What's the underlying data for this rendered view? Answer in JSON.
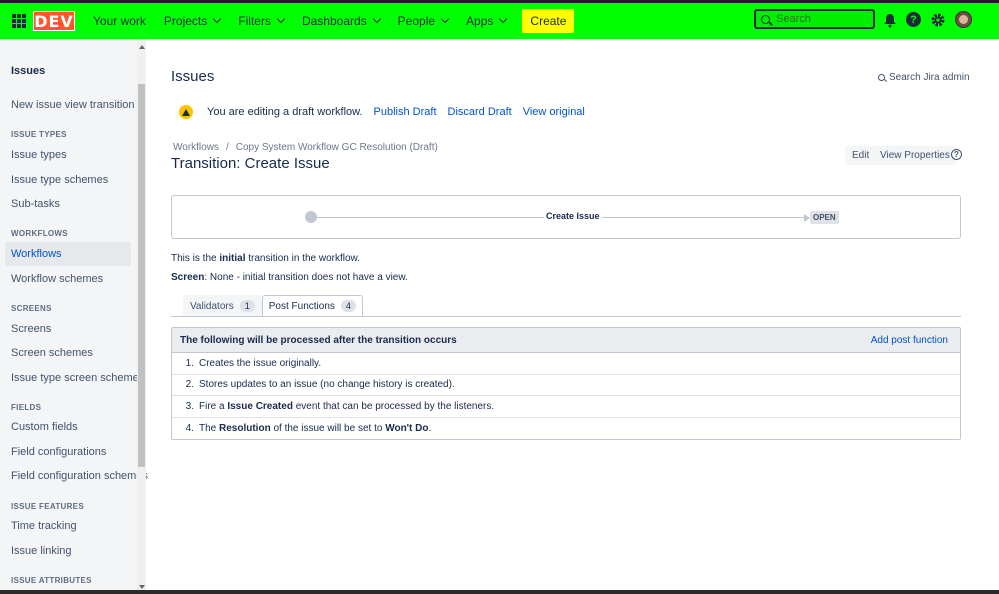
{
  "topbar": {
    "logo": "DEV",
    "nav": [
      {
        "label": "Your work",
        "dropdown": false
      },
      {
        "label": "Projects",
        "dropdown": true
      },
      {
        "label": "Filters",
        "dropdown": true
      },
      {
        "label": "Dashboards",
        "dropdown": true
      },
      {
        "label": "People",
        "dropdown": true
      },
      {
        "label": "Apps",
        "dropdown": true
      }
    ],
    "create_label": "Create",
    "search_placeholder": "Search",
    "help_glyph": "?",
    "colors": {
      "bar": "#00ff00",
      "create": "#ffff00",
      "logo": "#ff5630"
    },
    "icons": [
      "apps-grid-icon",
      "notifications-icon",
      "help-icon",
      "settings-icon",
      "avatar"
    ]
  },
  "sidebar": {
    "title": "Issues",
    "items": [
      {
        "type": "item",
        "label": "New issue view transition"
      },
      {
        "type": "head",
        "label": "ISSUE TYPES"
      },
      {
        "type": "item",
        "label": "Issue types"
      },
      {
        "type": "item",
        "label": "Issue type schemes"
      },
      {
        "type": "item",
        "label": "Sub-tasks"
      },
      {
        "type": "head",
        "label": "WORKFLOWS"
      },
      {
        "type": "item",
        "label": "Workflows",
        "active": true
      },
      {
        "type": "item",
        "label": "Workflow schemes"
      },
      {
        "type": "head",
        "label": "SCREENS"
      },
      {
        "type": "item",
        "label": "Screens"
      },
      {
        "type": "item",
        "label": "Screen schemes"
      },
      {
        "type": "item",
        "label": "Issue type screen schemes"
      },
      {
        "type": "head",
        "label": "FIELDS"
      },
      {
        "type": "item",
        "label": "Custom fields"
      },
      {
        "type": "item",
        "label": "Field configurations"
      },
      {
        "type": "item",
        "label": "Field configuration schemes"
      },
      {
        "type": "head",
        "label": "ISSUE FEATURES"
      },
      {
        "type": "item",
        "label": "Time tracking"
      },
      {
        "type": "item",
        "label": "Issue linking"
      },
      {
        "type": "head",
        "label": "ISSUE ATTRIBUTES"
      }
    ]
  },
  "main": {
    "title": "Issues",
    "admin_search": "Search Jira admin",
    "draft": {
      "message": "You are editing a draft workflow.",
      "publish": "Publish Draft",
      "discard": "Discard Draft",
      "view_original": "View original"
    },
    "breadcrumb": {
      "root": "Workflows",
      "separator": "/",
      "current": "Copy System Workflow GC Resolution (Draft)"
    },
    "transition_title": "Transition: Create Issue",
    "edit_label": "Edit",
    "properties_label": "View Properties",
    "help_glyph": "?",
    "diagram": {
      "transition": "Create Issue",
      "target_status": "OPEN"
    },
    "initial_text": {
      "pre": "This is the ",
      "bold": "initial",
      "post": " transition in the workflow."
    },
    "screen_text": {
      "label": "Screen",
      "value": ": None - initial transition does not have a view."
    },
    "tabs": [
      {
        "label": "Validators",
        "count": "1",
        "active": false
      },
      {
        "label": "Post Functions",
        "count": "4",
        "active": true
      }
    ],
    "post_functions": {
      "header": "The following will be processed after the transition occurs",
      "add_label": "Add post function",
      "rows": [
        {
          "num": "1.",
          "parts": [
            {
              "t": "Creates the issue originally.",
              "b": false
            }
          ]
        },
        {
          "num": "2.",
          "parts": [
            {
              "t": "Stores updates to an issue (no change history is created).",
              "b": false
            }
          ]
        },
        {
          "num": "3.",
          "parts": [
            {
              "t": "Fire a ",
              "b": false
            },
            {
              "t": "Issue Created",
              "b": true
            },
            {
              "t": " event that can be processed by the listeners.",
              "b": false
            }
          ]
        },
        {
          "num": "4.",
          "parts": [
            {
              "t": "The ",
              "b": false
            },
            {
              "t": "Resolution",
              "b": true
            },
            {
              "t": " of the issue will be set to ",
              "b": false
            },
            {
              "t": "Won't Do",
              "b": true
            },
            {
              "t": ".",
              "b": false
            }
          ]
        }
      ]
    }
  }
}
